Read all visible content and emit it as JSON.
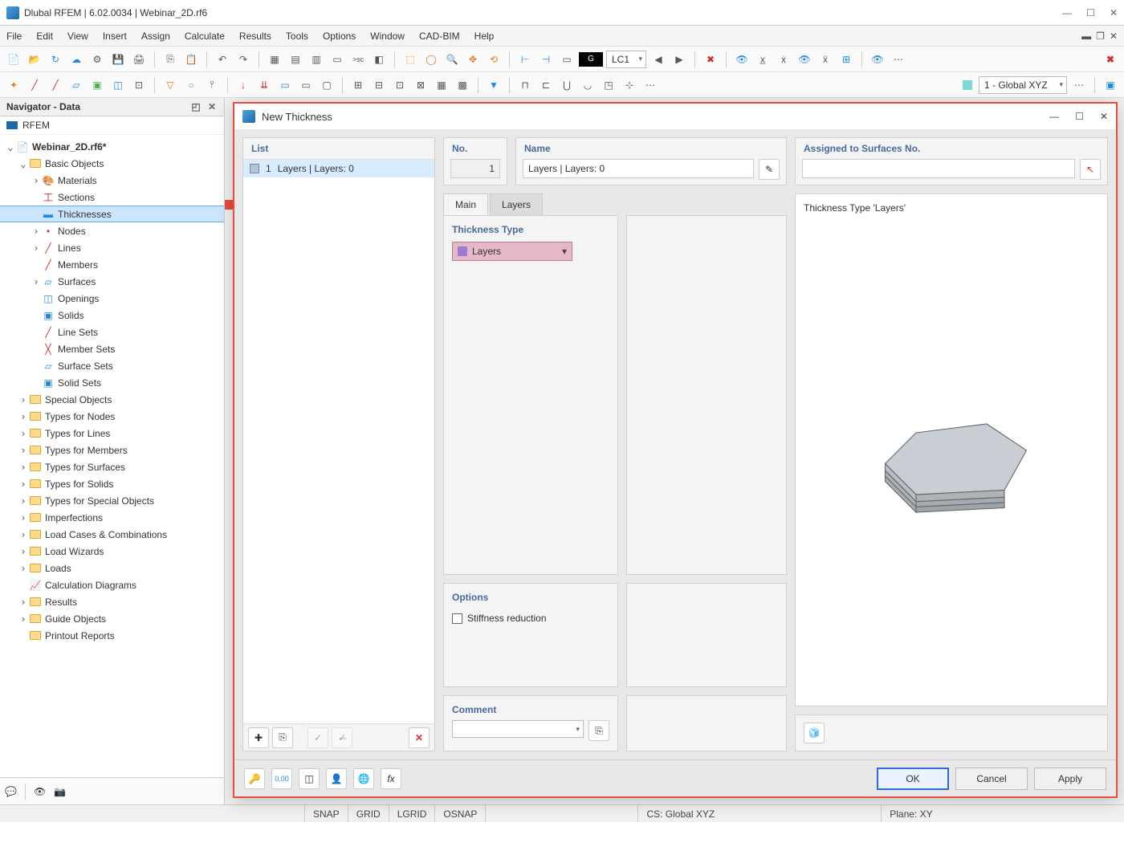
{
  "app": {
    "title": "Dlubal RFEM | 6.02.0034 | Webinar_2D.rf6"
  },
  "menubar": [
    "File",
    "Edit",
    "View",
    "Insert",
    "Assign",
    "Calculate",
    "Results",
    "Tools",
    "Options",
    "Window",
    "CAD-BIM",
    "Help"
  ],
  "toolbar2": {
    "coord_label": "1 - Global XYZ",
    "lc_label": "LC1",
    "lc_prefix": "G"
  },
  "navigator": {
    "title": "Navigator - Data",
    "root": "RFEM",
    "project": "Webinar_2D.rf6*",
    "basic": "Basic Objects",
    "items": [
      "Materials",
      "Sections",
      "Thicknesses",
      "Nodes",
      "Lines",
      "Members",
      "Surfaces",
      "Openings",
      "Solids",
      "Line Sets",
      "Member Sets",
      "Surface Sets",
      "Solid Sets"
    ],
    "groups": [
      "Special Objects",
      "Types for Nodes",
      "Types for Lines",
      "Types for Members",
      "Types for Surfaces",
      "Types for Solids",
      "Types for Special Objects",
      "Imperfections",
      "Load Cases & Combinations",
      "Load Wizards",
      "Loads",
      "Calculation Diagrams",
      "Results",
      "Guide Objects",
      "Printout Reports"
    ]
  },
  "dialog": {
    "title": "New Thickness",
    "list_header": "List",
    "list_item_no": "1",
    "list_item_text": "Layers | Layers: 0",
    "no_header": "No.",
    "no_value": "1",
    "name_header": "Name",
    "name_value": "Layers | Layers: 0",
    "assigned_header": "Assigned to Surfaces No.",
    "tab_main": "Main",
    "tab_layers": "Layers",
    "thickness_type_label": "Thickness Type",
    "thickness_type_value": "Layers",
    "options_label": "Options",
    "stiffness_label": "Stiffness reduction",
    "comment_label": "Comment",
    "preview_text": "Thickness Type  'Layers'",
    "btn_ok": "OK",
    "btn_cancel": "Cancel",
    "btn_apply": "Apply"
  },
  "statusbar": {
    "snap": "SNAP",
    "grid": "GRID",
    "lgrid": "LGRID",
    "osnap": "OSNAP",
    "cs": "CS: Global XYZ",
    "plane": "Plane: XY"
  }
}
